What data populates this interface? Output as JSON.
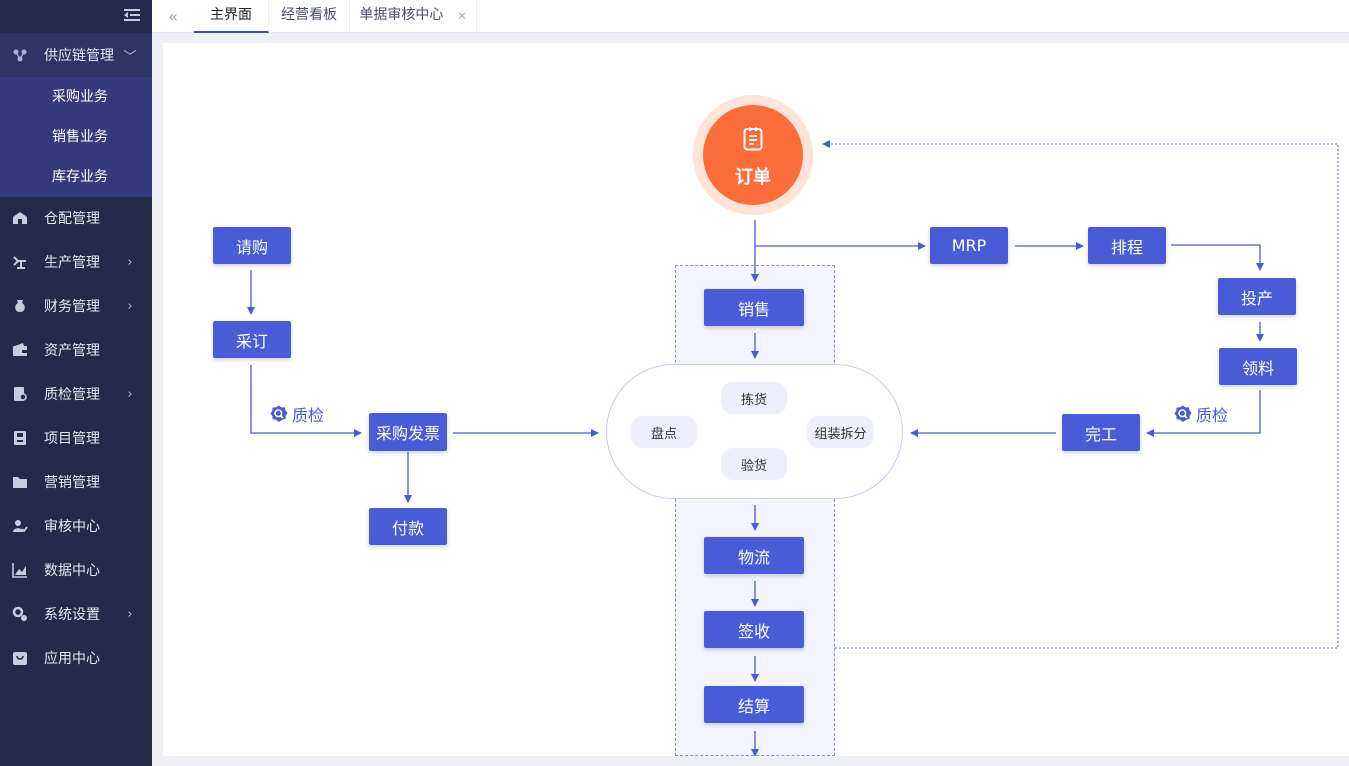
{
  "sidebar": {
    "items": [
      {
        "label": "供应链管理",
        "icon": "supply-chain-icon",
        "chevron": "﹀",
        "open": true
      },
      {
        "label": "仓配管理",
        "icon": "warehouse-icon",
        "chevron": ""
      },
      {
        "label": "生产管理",
        "icon": "production-icon",
        "chevron": "›"
      },
      {
        "label": "财务管理",
        "icon": "finance-icon",
        "chevron": "›"
      },
      {
        "label": "资产管理",
        "icon": "wallet-icon",
        "chevron": ""
      },
      {
        "label": "质检管理",
        "icon": "quality-icon",
        "chevron": "›"
      },
      {
        "label": "项目管理",
        "icon": "project-icon",
        "chevron": ""
      },
      {
        "label": "营销管理",
        "icon": "folder-icon",
        "chevron": ""
      },
      {
        "label": "审核中心",
        "icon": "audit-icon",
        "chevron": ""
      },
      {
        "label": "数据中心",
        "icon": "chart-icon",
        "chevron": ""
      },
      {
        "label": "系统设置",
        "icon": "settings-icon",
        "chevron": "›"
      },
      {
        "label": "应用中心",
        "icon": "app-icon",
        "chevron": ""
      }
    ],
    "submenu": [
      "采购业务",
      "销售业务",
      "库存业务"
    ]
  },
  "tabs": {
    "back_icon": "«",
    "items": [
      {
        "label": "主界面",
        "active": true
      },
      {
        "label": "经营看板",
        "active": false
      },
      {
        "label": "单据审核中心",
        "active": false,
        "close": "×"
      }
    ]
  },
  "flow": {
    "order": "订单",
    "purchase_request": "请购",
    "purchase_order": "采订",
    "purchase_invoice": "采购发票",
    "payment": "付款",
    "qc_left": "质检",
    "qc_right": "质检",
    "sales": "销售",
    "picking": "拣货",
    "stocktake": "盘点",
    "inspection": "验货",
    "assembly": "组装拆分",
    "logistics": "物流",
    "sign": "签收",
    "settlement": "结算",
    "mrp": "MRP",
    "schedule": "排程",
    "produce": "投产",
    "material": "领料",
    "complete": "完工"
  },
  "colors": {
    "sidebar_bg": "#26294a",
    "submenu_bg": "#353b7a",
    "box": "#4a5bd8",
    "order": "#fb6d3a",
    "order_halo": "#fde3d8",
    "line": "#4a5bd8"
  }
}
